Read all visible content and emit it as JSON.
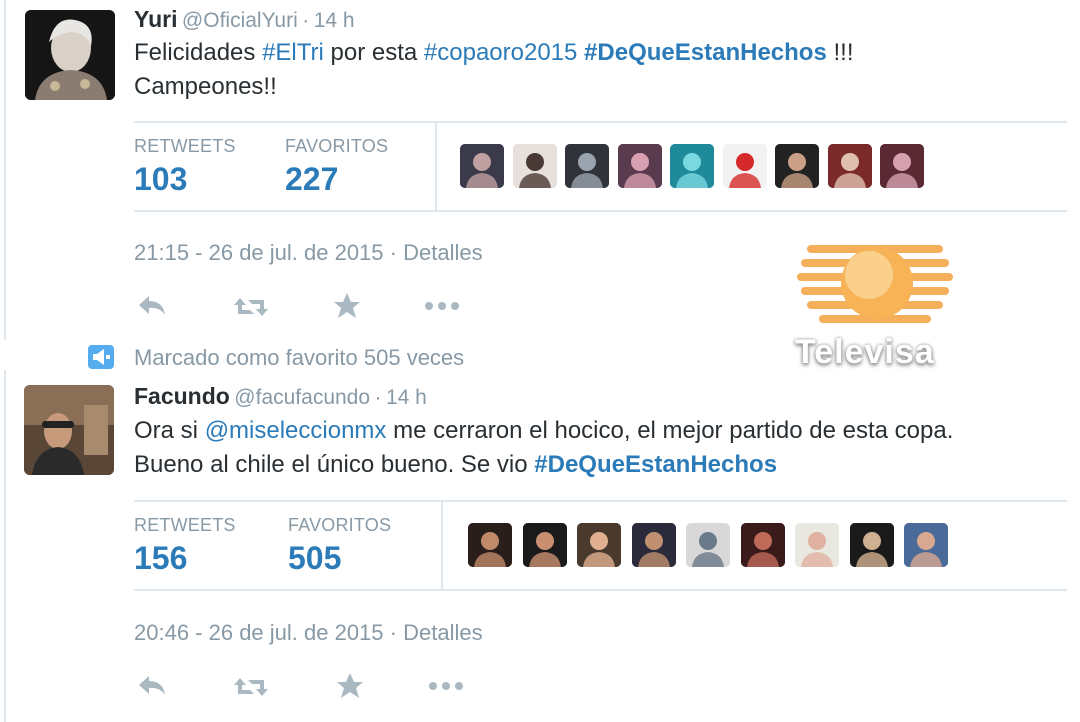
{
  "tweet1": {
    "name": "Yuri",
    "handle": "@OficialYuri",
    "time": "14 h",
    "text_parts": [
      {
        "t": "Felicidades ",
        "tag": false
      },
      {
        "t": "#ElTri",
        "tag": true
      },
      {
        "t": " por esta ",
        "tag": false
      },
      {
        "t": "#copaoro2015",
        "tag": true
      },
      {
        "t": " ",
        "tag": false
      },
      {
        "t": "#DeQueEstanHechos",
        "tag": true,
        "bold": true
      },
      {
        "t": " !!!",
        "tag": false
      }
    ],
    "text_line2": "Campeones!!",
    "retweets_label": "RETWEETS",
    "retweets": "103",
    "favorites_label": "FAVORITOS",
    "favorites": "227",
    "date": "21:15 - 26 de jul. de 2015",
    "details": "Detalles"
  },
  "favorite_note": "Marcado como favorito 505 veces",
  "tweet2": {
    "name": "Facundo",
    "handle": "@facufacundo",
    "time": "14 h",
    "line1_parts": [
      {
        "t": "Ora si ",
        "tag": false
      },
      {
        "t": "@miseleccionmx",
        "tag": true
      },
      {
        "t": " me cerraron el hocico, el mejor partido de esta copa.",
        "tag": false
      }
    ],
    "line2_parts": [
      {
        "t": "Bueno al chile el único bueno. Se vio ",
        "tag": false
      },
      {
        "t": "#DeQueEstanHechos",
        "tag": true,
        "bold": true
      }
    ],
    "retweets_label": "RETWEETS",
    "retweets": "156",
    "favorites_label": "FAVORITOS",
    "favorites": "505",
    "date": "20:46 - 26 de jul. de 2015",
    "details": "Detalles"
  },
  "watermark": "Televisa",
  "icons": [
    "reply-icon",
    "retweet-icon",
    "favorite-icon",
    "more-icon",
    "promoted-icon"
  ],
  "colors": {
    "link": "#2b7bb9",
    "muted": "#8899a6",
    "icon": "#aab8c2",
    "border": "#e1e8ed",
    "watermark": "#f2932a"
  }
}
